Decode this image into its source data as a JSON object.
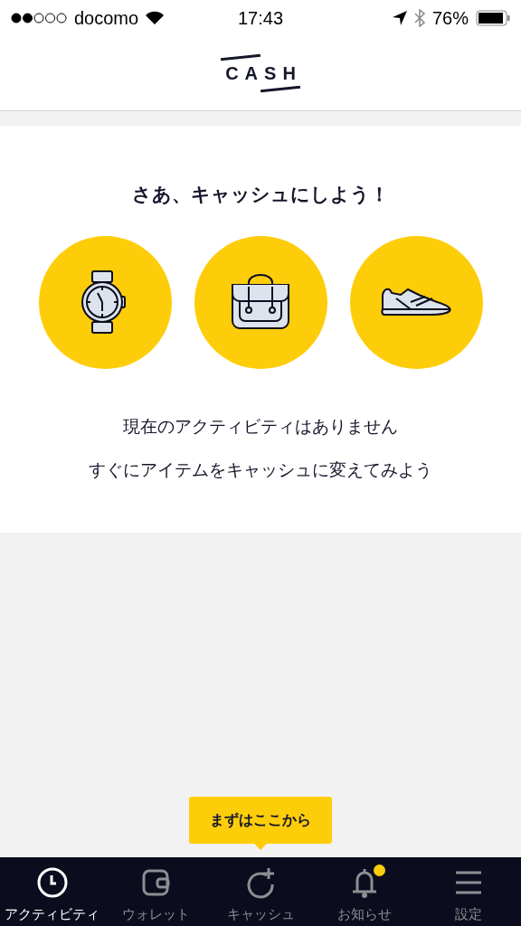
{
  "status_bar": {
    "carrier": "docomo",
    "time": "17:43",
    "battery": "76%"
  },
  "header": {
    "logo": "CASH"
  },
  "empty_state": {
    "title": "さあ、キャッシュにしよう！",
    "message": "現在のアクティビティはありません",
    "hint": "すぐにアイテムをキャッシュに変えてみよう"
  },
  "tooltip": {
    "text": "まずはここから"
  },
  "tab_bar": [
    {
      "label": "アクティビティ",
      "selected": true,
      "badge": false
    },
    {
      "label": "ウォレット",
      "selected": false,
      "badge": false
    },
    {
      "label": "キャッシュ",
      "selected": false,
      "badge": false
    },
    {
      "label": "お知らせ",
      "selected": false,
      "badge": true
    },
    {
      "label": "設定",
      "selected": false,
      "badge": false
    }
  ]
}
